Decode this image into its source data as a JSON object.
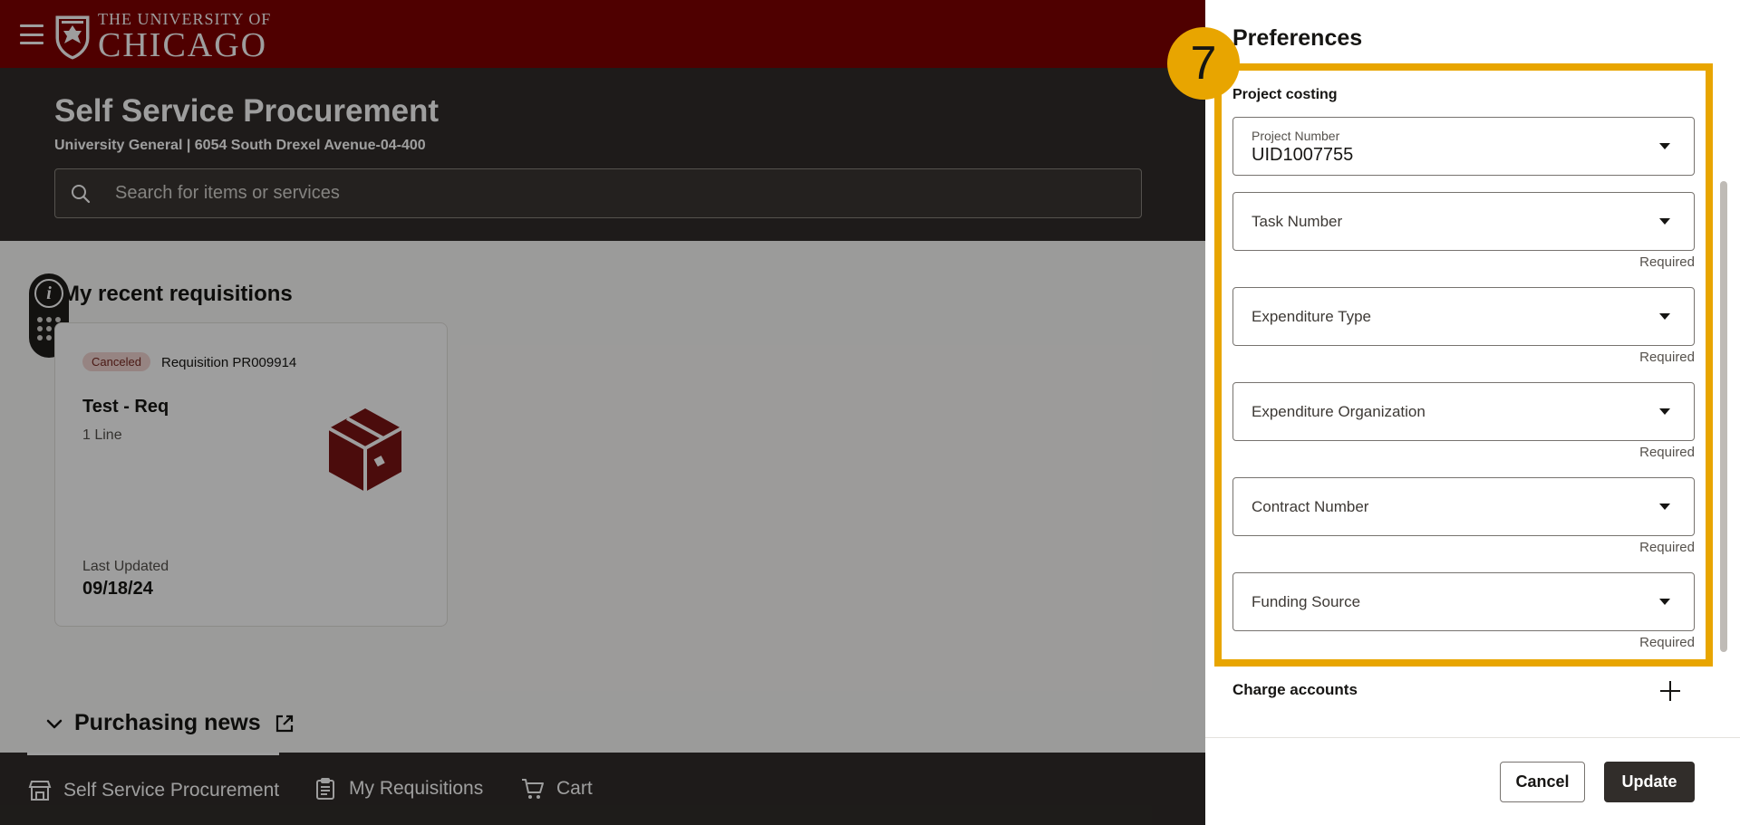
{
  "header": {
    "logo_line1": "THE UNIVERSITY OF",
    "logo_line2": "CHICAGO",
    "brand_color": "#800000"
  },
  "hero": {
    "title": "Self Service Procurement",
    "subtitle": "University General | 6054 South Drexel Avenue-04-400",
    "search_placeholder": "Search for items or services"
  },
  "recent": {
    "title": "My recent requisitions",
    "card": {
      "status": "Canceled",
      "requisition": "Requisition PR009914",
      "name": "Test - Req",
      "lines": "1 Line",
      "updated_label": "Last Updated",
      "updated_value": "09/18/24"
    }
  },
  "news": {
    "title": "Purchasing news"
  },
  "bottom_nav": {
    "items": [
      {
        "label": "Self Service Procurement",
        "icon": "store-icon"
      },
      {
        "label": "My Requisitions",
        "icon": "clipboard-icon"
      },
      {
        "label": "Cart",
        "icon": "cart-icon"
      }
    ]
  },
  "drawer": {
    "title": "Preferences",
    "step_number": "7",
    "group_title": "Project costing",
    "fields": [
      {
        "label": "Project Number",
        "value": "UID1007755",
        "required": ""
      },
      {
        "label": "Task Number",
        "value": "",
        "required": "Required"
      },
      {
        "label": "Expenditure Type",
        "value": "",
        "required": "Required"
      },
      {
        "label": "Expenditure Organization",
        "value": "",
        "required": "Required"
      },
      {
        "label": "Contract Number",
        "value": "",
        "required": "Required"
      },
      {
        "label": "Funding Source",
        "value": "",
        "required": "Required"
      }
    ],
    "charge_accounts": "Charge accounts",
    "cancel_label": "Cancel",
    "update_label": "Update",
    "highlight_color": "#e8a500"
  }
}
